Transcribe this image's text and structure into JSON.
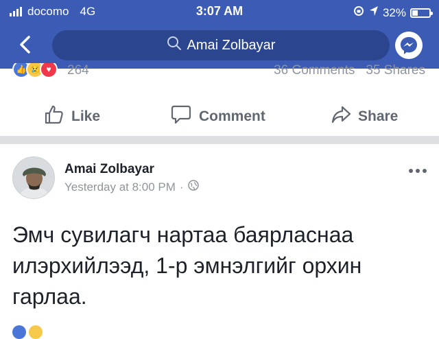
{
  "status": {
    "carrier": "docomo",
    "network": "4G",
    "time": "3:07 AM",
    "battery": "32%",
    "battery_level": 0.32
  },
  "header": {
    "search_text": "Amai Zolbayar",
    "icons": [
      "back-chevron-icon",
      "search-icon",
      "messenger-icon"
    ]
  },
  "prev_post": {
    "reaction_count": "264",
    "comments": "36 Comments",
    "shares": "35 Shares",
    "actions": {
      "like": "Like",
      "comment": "Comment",
      "share": "Share"
    }
  },
  "post": {
    "author": "Amai Zolbayar",
    "time": "Yesterday at 8:00 PM",
    "separator": "·",
    "text": "Эмч сувилагч нартаа баярласнаа илэрхийлээд, 1-р эмнэлгийг орхин гарлаа."
  },
  "colors": {
    "brand": "#3b5bb5",
    "search_bg": "#2b468f",
    "text_muted": "#8d949e",
    "action_gray": "#606770"
  }
}
